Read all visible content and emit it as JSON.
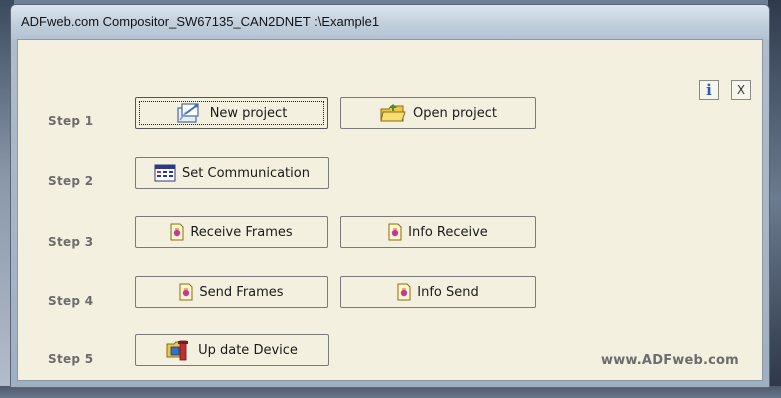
{
  "window": {
    "title": "ADFweb.com Compositor_SW67135_CAN2DNET :\\Example1"
  },
  "top_controls": {
    "info_glyph": "i",
    "close_glyph": "X"
  },
  "steps": [
    {
      "label": "Step 1"
    },
    {
      "label": "Step 2"
    },
    {
      "label": "Step 3"
    },
    {
      "label": "Step 4"
    },
    {
      "label": "Step 5"
    }
  ],
  "buttons": {
    "new_project": "New project",
    "open_project": "Open project",
    "set_communication": "Set Communication",
    "receive_frames": "Receive Frames",
    "info_receive": "Info Receive",
    "send_frames": "Send Frames",
    "info_send": "Info Send",
    "update_device": "Up date Device"
  },
  "footer": {
    "brand": "www.ADFweb.com"
  },
  "icons": {
    "new_project": "new-project-icon",
    "open_project": "open-folder-icon",
    "set_communication": "communication-settings-icon",
    "frames": "frame-document-icon",
    "update_device": "update-device-icon",
    "info": "info-icon",
    "close": "close-icon"
  },
  "colors": {
    "client_bg": "#f3f0e0",
    "step_label": "#6c6c6c",
    "info_blue": "#1f5fbf"
  }
}
